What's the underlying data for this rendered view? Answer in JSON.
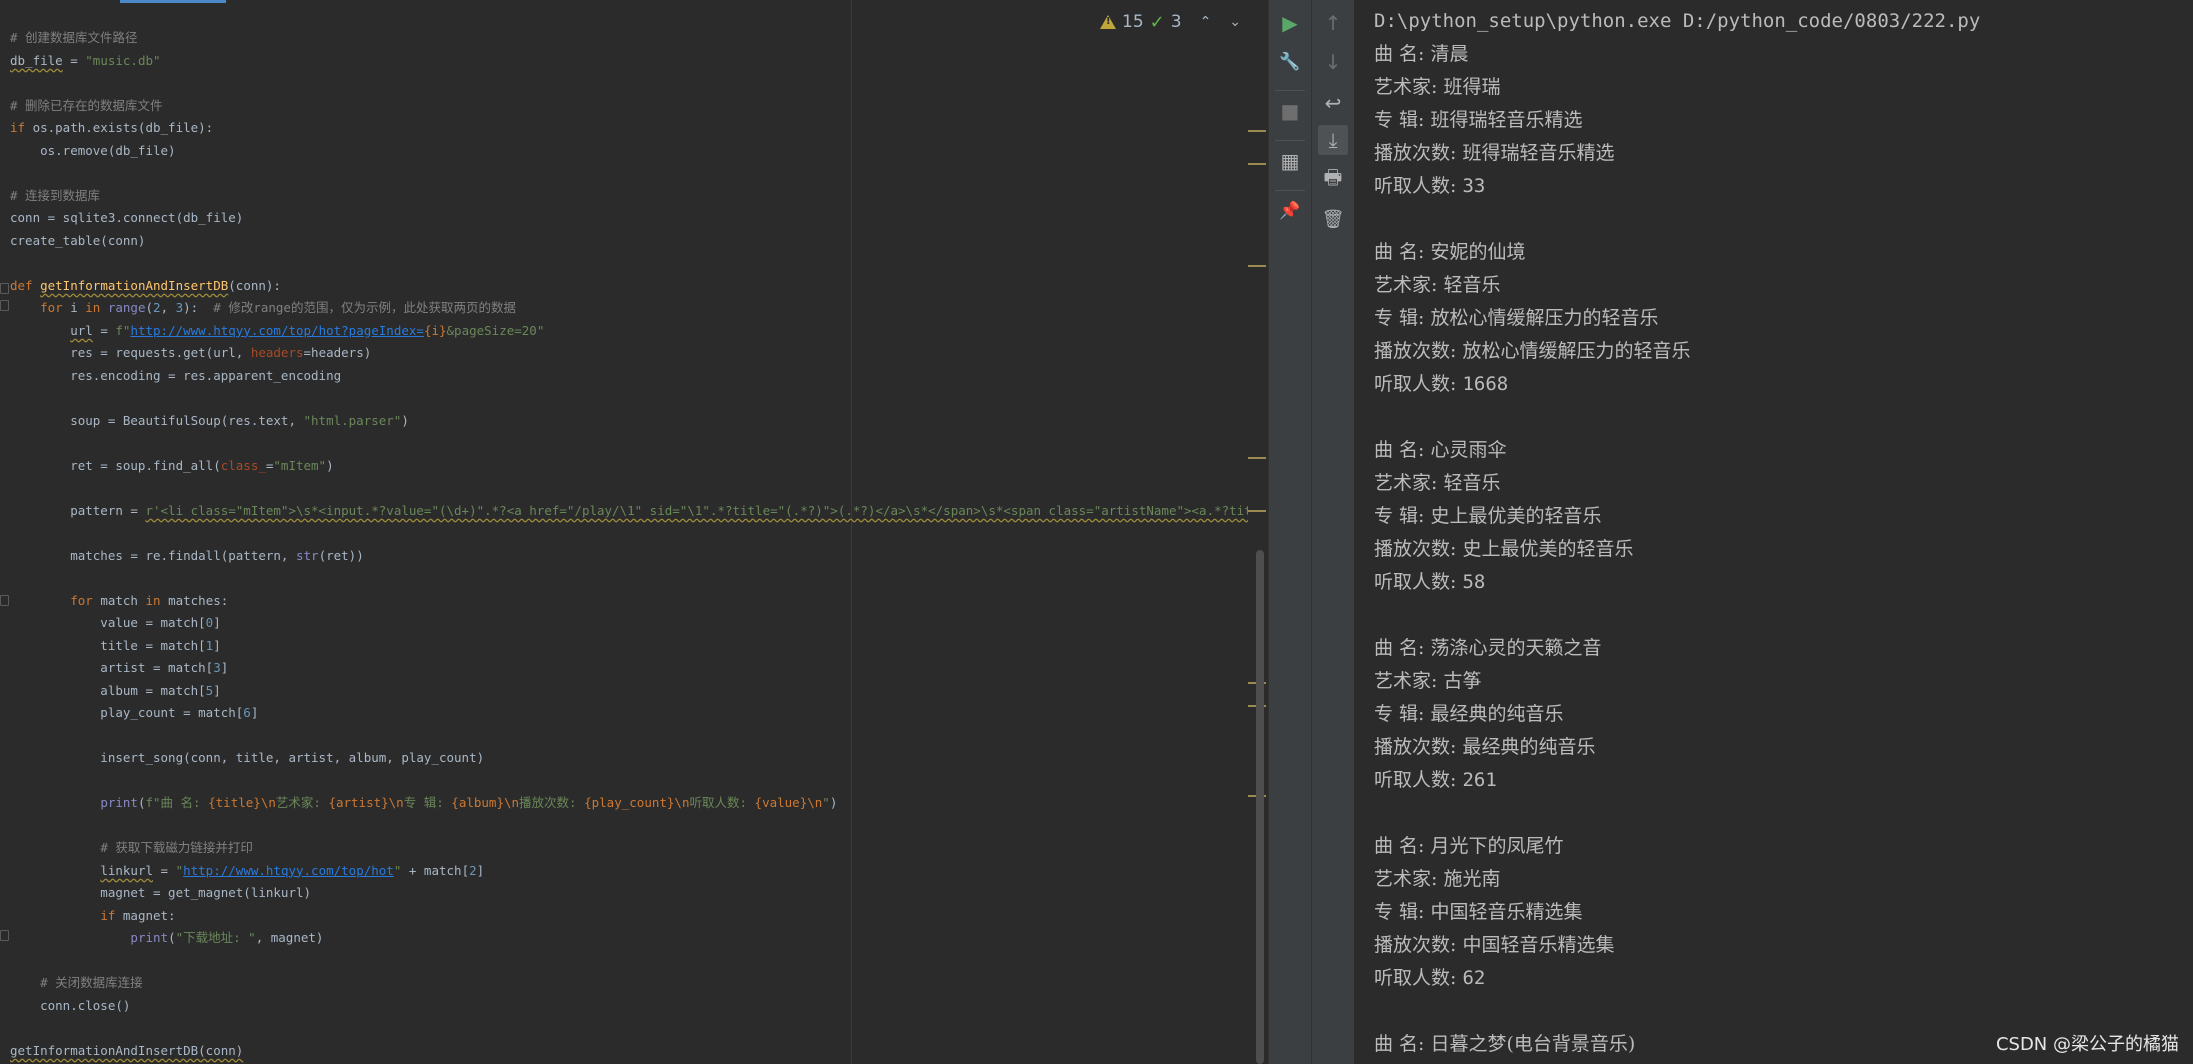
{
  "editor": {
    "lines": [
      [
        {
          "c": "cmt",
          "t": "# 创建数据库文件路径"
        }
      ],
      [
        {
          "c": "wavy",
          "t": "db_file"
        },
        {
          "t": " = "
        },
        {
          "c": "str",
          "t": "\"music.db\""
        }
      ],
      [],
      [
        {
          "c": "cmt",
          "t": "# 删除已存在的数据库文件"
        }
      ],
      [
        {
          "c": "kw",
          "t": "if "
        },
        {
          "t": "os.path.exists(db_file):"
        }
      ],
      [
        {
          "t": "    os.remove(db_file)"
        }
      ],
      [],
      [
        {
          "c": "cmt",
          "t": "# 连接到数据库"
        }
      ],
      [
        {
          "t": "conn = sqlite3.connect(db_file)"
        }
      ],
      [
        {
          "t": "create_table(conn)"
        }
      ],
      [],
      [
        {
          "c": "kw",
          "t": "def "
        },
        {
          "c": "fn wavy",
          "t": "getInformationAndInsertDB"
        },
        {
          "t": "(conn):"
        }
      ],
      [
        {
          "t": "    "
        },
        {
          "c": "kw",
          "t": "for "
        },
        {
          "t": "i "
        },
        {
          "c": "kw",
          "t": "in "
        },
        {
          "c": "builtin",
          "t": "range"
        },
        {
          "t": "("
        },
        {
          "c": "num",
          "t": "2"
        },
        {
          "t": ", "
        },
        {
          "c": "num",
          "t": "3"
        },
        {
          "t": "):  "
        },
        {
          "c": "cmt",
          "t": "# 修改range的范围，仅为示例，此处获取两页的数据"
        }
      ],
      [
        {
          "t": "        "
        },
        {
          "c": "wavy",
          "t": "url"
        },
        {
          "t": " = "
        },
        {
          "c": "str",
          "t": "f\""
        },
        {
          "c": "url",
          "t": "http://www.htqyy.com/top/hot?pageIndex="
        },
        {
          "c": "fmt",
          "t": "{i}"
        },
        {
          "c": "str",
          "t": "&pageSize=20\""
        }
      ],
      [
        {
          "t": "        res = requests.get(url, "
        },
        {
          "c": "param",
          "t": "headers"
        },
        {
          "t": "=headers)"
        }
      ],
      [
        {
          "t": "        res.encoding = res.apparent_encoding"
        }
      ],
      [],
      [
        {
          "t": "        soup = BeautifulSoup(res.text, "
        },
        {
          "c": "str",
          "t": "\"html.parser\""
        },
        {
          "t": ")"
        }
      ],
      [],
      [
        {
          "t": "        ret = soup.find_all("
        },
        {
          "c": "param",
          "t": "class_"
        },
        {
          "t": "="
        },
        {
          "c": "str",
          "t": "\"mItem\""
        },
        {
          "t": ")"
        }
      ],
      [],
      [
        {
          "t": "        pattern = "
        },
        {
          "c": "str wavy",
          "t": "r'<li class=\"mItem\">\\s*<input.*?value=\"(\\d+)\".*?<a href=\"/play/\\1\" sid=\"\\1\".*?title=\"(.*?)\">(.*?)</a>\\s*</span>\\s*<span class=\"artistName\"><a.*?title=\"(.*?)\">(.*?)</a>'"
        }
      ],
      [],
      [
        {
          "t": "        matches = re.findall(pattern, "
        },
        {
          "c": "builtin",
          "t": "str"
        },
        {
          "t": "(ret))"
        }
      ],
      [],
      [
        {
          "t": "        "
        },
        {
          "c": "kw",
          "t": "for "
        },
        {
          "t": "match "
        },
        {
          "c": "kw",
          "t": "in "
        },
        {
          "t": "matches:"
        }
      ],
      [
        {
          "t": "            value = match["
        },
        {
          "c": "num",
          "t": "0"
        },
        {
          "t": "]"
        }
      ],
      [
        {
          "t": "            title = match["
        },
        {
          "c": "num",
          "t": "1"
        },
        {
          "t": "]"
        }
      ],
      [
        {
          "t": "            artist = match["
        },
        {
          "c": "num",
          "t": "3"
        },
        {
          "t": "]"
        }
      ],
      [
        {
          "t": "            album = match["
        },
        {
          "c": "num",
          "t": "5"
        },
        {
          "t": "]"
        }
      ],
      [
        {
          "t": "            play_count = match["
        },
        {
          "c": "num",
          "t": "6"
        },
        {
          "t": "]"
        }
      ],
      [],
      [
        {
          "t": "            insert_song(conn, title, artist, album, play_count)"
        }
      ],
      [],
      [
        {
          "t": "            "
        },
        {
          "c": "builtin",
          "t": "print"
        },
        {
          "t": "("
        },
        {
          "c": "str",
          "t": "f\"曲 名: "
        },
        {
          "c": "fmt",
          "t": "{title}"
        },
        {
          "c": "kw",
          "t": "\\n"
        },
        {
          "c": "str",
          "t": "艺术家: "
        },
        {
          "c": "fmt",
          "t": "{artist}"
        },
        {
          "c": "kw",
          "t": "\\n"
        },
        {
          "c": "str",
          "t": "专 辑: "
        },
        {
          "c": "fmt",
          "t": "{album}"
        },
        {
          "c": "kw",
          "t": "\\n"
        },
        {
          "c": "str",
          "t": "播放次数: "
        },
        {
          "c": "fmt",
          "t": "{play_count}"
        },
        {
          "c": "kw",
          "t": "\\n"
        },
        {
          "c": "str",
          "t": "听取人数: "
        },
        {
          "c": "fmt",
          "t": "{value}"
        },
        {
          "c": "kw",
          "t": "\\n"
        },
        {
          "c": "str",
          "t": "\""
        },
        {
          "t": ")"
        }
      ],
      [],
      [
        {
          "t": "            "
        },
        {
          "c": "cmt",
          "t": "# 获取下载磁力链接并打印"
        }
      ],
      [
        {
          "t": "            "
        },
        {
          "c": "wavy",
          "t": "linkurl"
        },
        {
          "t": " = "
        },
        {
          "c": "str",
          "t": "\""
        },
        {
          "c": "url",
          "t": "http://www.htqyy.com/top/hot"
        },
        {
          "c": "str",
          "t": "\""
        },
        {
          "t": " + match["
        },
        {
          "c": "num",
          "t": "2"
        },
        {
          "t": "]"
        }
      ],
      [
        {
          "t": "            magnet = get_magnet(linkurl)"
        }
      ],
      [
        {
          "t": "            "
        },
        {
          "c": "kw",
          "t": "if "
        },
        {
          "t": "magnet:"
        }
      ],
      [
        {
          "t": "                "
        },
        {
          "c": "builtin",
          "t": "print"
        },
        {
          "t": "("
        },
        {
          "c": "str",
          "t": "\"下载地址: \""
        },
        {
          "t": ", magnet)"
        }
      ],
      [],
      [
        {
          "t": "    "
        },
        {
          "c": "cmt",
          "t": "# 关闭数据库连接"
        }
      ],
      [
        {
          "t": "    conn.close()"
        }
      ],
      [],
      [
        {
          "c": "wavy",
          "t": "getInformationAndInsertDB(conn)"
        }
      ]
    ],
    "inspection": {
      "warnings_count": "15",
      "typos_count": "3",
      "prev_label": "⌃",
      "next_label": "⌄"
    }
  },
  "toolbar": {
    "run_icon": "▶",
    "wrench_icon": "🔧",
    "stop_icon": "■",
    "layout_icon": "▦",
    "pin_icon": "📌",
    "up_icon": "↑",
    "down_icon": "↓",
    "wrap_icon": "↩",
    "scroll_end_icon": "⤓",
    "print_icon": "🖶",
    "trash_icon": "🗑"
  },
  "console": {
    "command": "D:\\python_setup\\python.exe D:/python_code/0803/222.py",
    "records": [
      {
        "title": "曲 名: 清晨",
        "artist": "艺术家: 班得瑞",
        "album": "专 辑: 班得瑞轻音乐精选",
        "plays": "播放次数: 班得瑞轻音乐精选",
        "listeners_label": "听取人数: ",
        "listeners": "33"
      },
      {
        "title": "曲 名: 安妮的仙境",
        "artist": "艺术家: 轻音乐",
        "album": "专 辑: 放松心情缓解压力的轻音乐",
        "plays": "播放次数: 放松心情缓解压力的轻音乐",
        "listeners_label": "听取人数: ",
        "listeners": "1668"
      },
      {
        "title": "曲 名: 心灵雨伞",
        "artist": "艺术家: 轻音乐",
        "album": "专 辑: 史上最优美的轻音乐",
        "plays": "播放次数: 史上最优美的轻音乐",
        "listeners_label": "听取人数: ",
        "listeners": "58"
      },
      {
        "title": "曲 名: 荡涤心灵的天籁之音",
        "artist": "艺术家: 古筝",
        "album": "专 辑: 最经典的纯音乐",
        "plays": "播放次数: 最经典的纯音乐",
        "listeners_label": "听取人数: ",
        "listeners": "261"
      },
      {
        "title": "曲 名: 月光下的凤尾竹",
        "artist": "艺术家: 施光南",
        "album": "专 辑: 中国轻音乐精选集",
        "plays": "播放次数: 中国轻音乐精选集",
        "listeners_label": "听取人数: ",
        "listeners": "62"
      }
    ],
    "last_line": "曲 名: 日暮之梦(电台背景音乐)"
  },
  "watermark": "CSDN @梁公子的橘猫"
}
